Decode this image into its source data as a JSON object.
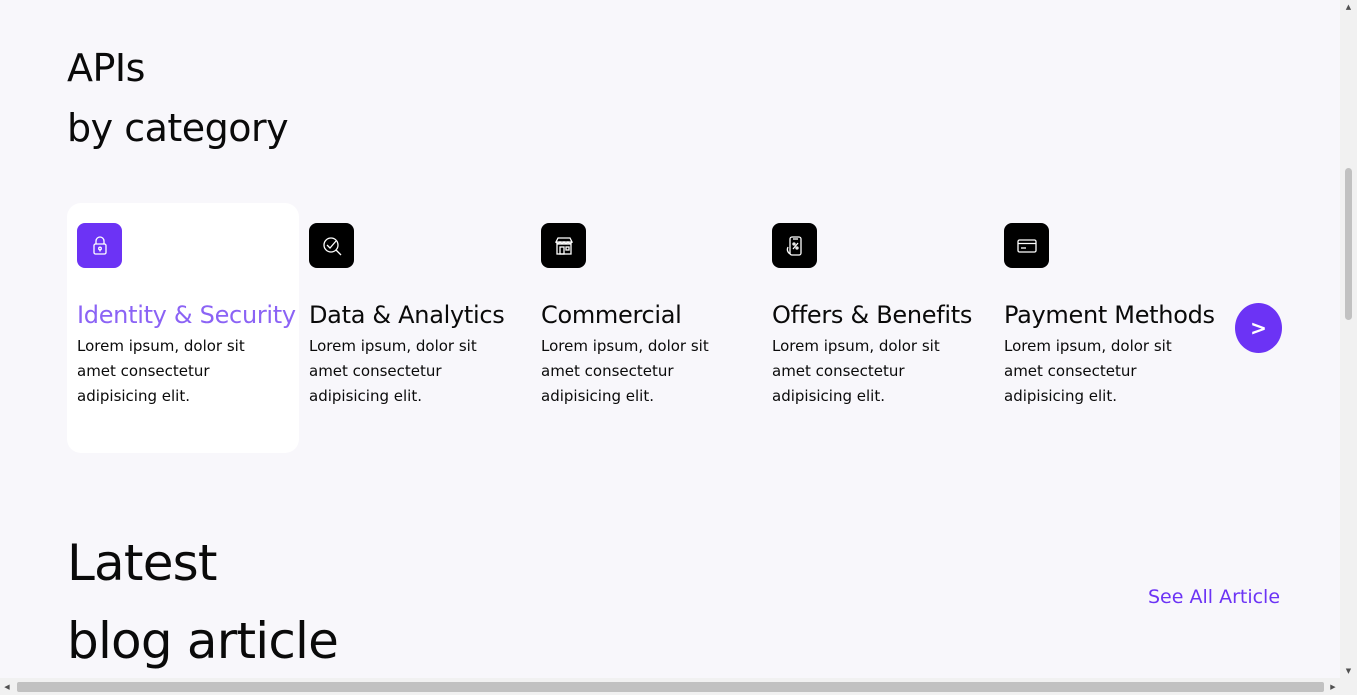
{
  "apis": {
    "title_line1": "APIs",
    "title_line2": "by category"
  },
  "categories": [
    {
      "title": "Identity & Security",
      "desc": "Lorem ipsum, dolor sit amet consectetur adipisicing elit.",
      "icon": "lock-icon",
      "active": true
    },
    {
      "title": "Data & Analytics",
      "desc": "Lorem ipsum, dolor sit amet consectetur adipisicing elit.",
      "icon": "analytics-search-icon",
      "active": false
    },
    {
      "title": "Commercial",
      "desc": "Lorem ipsum, dolor sit amet consectetur adipisicing elit.",
      "icon": "storefront-icon",
      "active": false
    },
    {
      "title": "Offers & Benefits",
      "desc": "Lorem ipsum, dolor sit amet consectetur adipisicing elit.",
      "icon": "phone-offer-icon",
      "active": false
    },
    {
      "title": "Payment Methods",
      "desc": "Lorem ipsum, dolor sit amet consectetur adipisicing elit.",
      "icon": "credit-card-icon",
      "active": false
    }
  ],
  "next_button": {
    "label": ">"
  },
  "blog": {
    "title_line1": "Latest",
    "title_line2": "blog article",
    "see_all": "See All Article"
  },
  "colors": {
    "accent": "#6c33f5",
    "active_title": "#8b63f5",
    "background": "#f8f7fb"
  }
}
